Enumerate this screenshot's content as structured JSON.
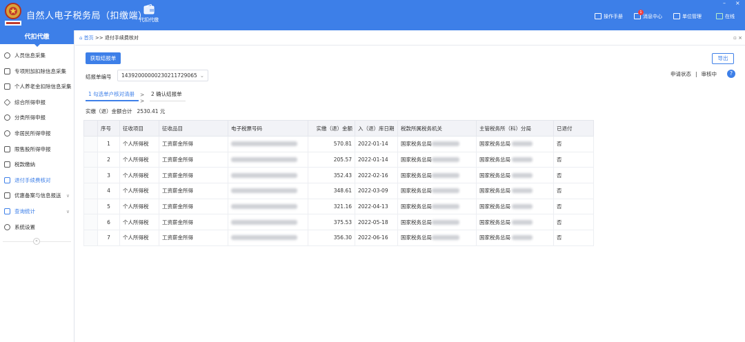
{
  "header": {
    "title": "自然人电子税务局（扣缴端）",
    "nav_daikou": "代扣代缴",
    "manual": "操作手册",
    "messages": "消息中心",
    "message_count": "1",
    "unit_mgmt": "单位管理",
    "online": "在线",
    "win_min": "–",
    "win_close": "×"
  },
  "sidebar": {
    "title": "代扣代缴",
    "collapse": "«",
    "items": [
      {
        "label": "人员信息采集",
        "icon": "person-icon"
      },
      {
        "label": "专项附加扣除信息采集",
        "icon": "grid-icon"
      },
      {
        "label": "个人养老金扣除信息采集",
        "icon": "list-icon"
      },
      {
        "label": "综合所得申报",
        "icon": "layers-icon"
      },
      {
        "label": "分类所得申报",
        "icon": "pie-icon"
      },
      {
        "label": "非居民所得申报",
        "icon": "user-alt-icon"
      },
      {
        "label": "限售股所得申报",
        "icon": "bar-icon"
      },
      {
        "label": "税款缴纳",
        "icon": "folder-icon"
      },
      {
        "label": "退付手续费核对",
        "icon": "doc-icon"
      },
      {
        "label": "优惠备案与信息报送",
        "icon": "doc-outline-icon"
      },
      {
        "label": "查询统计",
        "icon": "search-doc-icon"
      },
      {
        "label": "系统设置",
        "icon": "gear-icon"
      }
    ],
    "chevron": "∨"
  },
  "breadcrumb": {
    "home": "首页",
    "sep": ">>",
    "current": "退付手续费核对",
    "ctrl": "▫ ×"
  },
  "toolbar": {
    "fetch_label": "获取结报单",
    "export_label": "导出"
  },
  "settlement": {
    "label": "结报单编号",
    "value": "14392000000230211729065",
    "caret": "⌄"
  },
  "status": {
    "label": "申请状态",
    "sep": "|",
    "value": "审核中",
    "help": "?"
  },
  "steps": {
    "step1": "1 勾选单户核对清册",
    "sep": "> >",
    "step2": "2 确认结报单"
  },
  "total": {
    "label": "实缴（退）金额合计",
    "amount": "2530.41 元"
  },
  "table": {
    "headers": [
      "序号",
      "征收项目",
      "征收品目",
      "电子税票号码",
      "实缴（退）金额",
      "入（退）库日期",
      "税款所属税务机关",
      "主管税务所（科）分局",
      "已退付"
    ],
    "rows": [
      {
        "seq": "1",
        "item": "个人所得税",
        "sub": "工资薪金所得",
        "amount": "570.81",
        "date": "2022-01-14",
        "org": "国家税务总局",
        "branch": "国家税务总局",
        "refunded": "否"
      },
      {
        "seq": "2",
        "item": "个人所得税",
        "sub": "工资薪金所得",
        "amount": "205.57",
        "date": "2022-01-14",
        "org": "国家税务总局",
        "branch": "国家税务总局",
        "refunded": "否"
      },
      {
        "seq": "3",
        "item": "个人所得税",
        "sub": "工资薪金所得",
        "amount": "352.43",
        "date": "2022-02-16",
        "org": "国家税务总局",
        "branch": "国家税务总局",
        "refunded": "否"
      },
      {
        "seq": "4",
        "item": "个人所得税",
        "sub": "工资薪金所得",
        "amount": "348.61",
        "date": "2022-03-09",
        "org": "国家税务总局",
        "branch": "国家税务总局",
        "refunded": "否"
      },
      {
        "seq": "5",
        "item": "个人所得税",
        "sub": "工资薪金所得",
        "amount": "321.16",
        "date": "2022-04-13",
        "org": "国家税务总局",
        "branch": "国家税务总局",
        "refunded": "否"
      },
      {
        "seq": "6",
        "item": "个人所得税",
        "sub": "工资薪金所得",
        "amount": "375.53",
        "date": "2022-05-18",
        "org": "国家税务总局",
        "branch": "国家税务总局",
        "refunded": "否"
      },
      {
        "seq": "7",
        "item": "个人所得税",
        "sub": "工资薪金所得",
        "amount": "356.30",
        "date": "2022-06-16",
        "org": "国家税务总局",
        "branch": "国家税务总局",
        "refunded": "否"
      }
    ]
  },
  "colors": {
    "primary": "#3d7fe8",
    "header_bg": "#3d7fe8",
    "table_head_bg": "#f2f3f7"
  }
}
